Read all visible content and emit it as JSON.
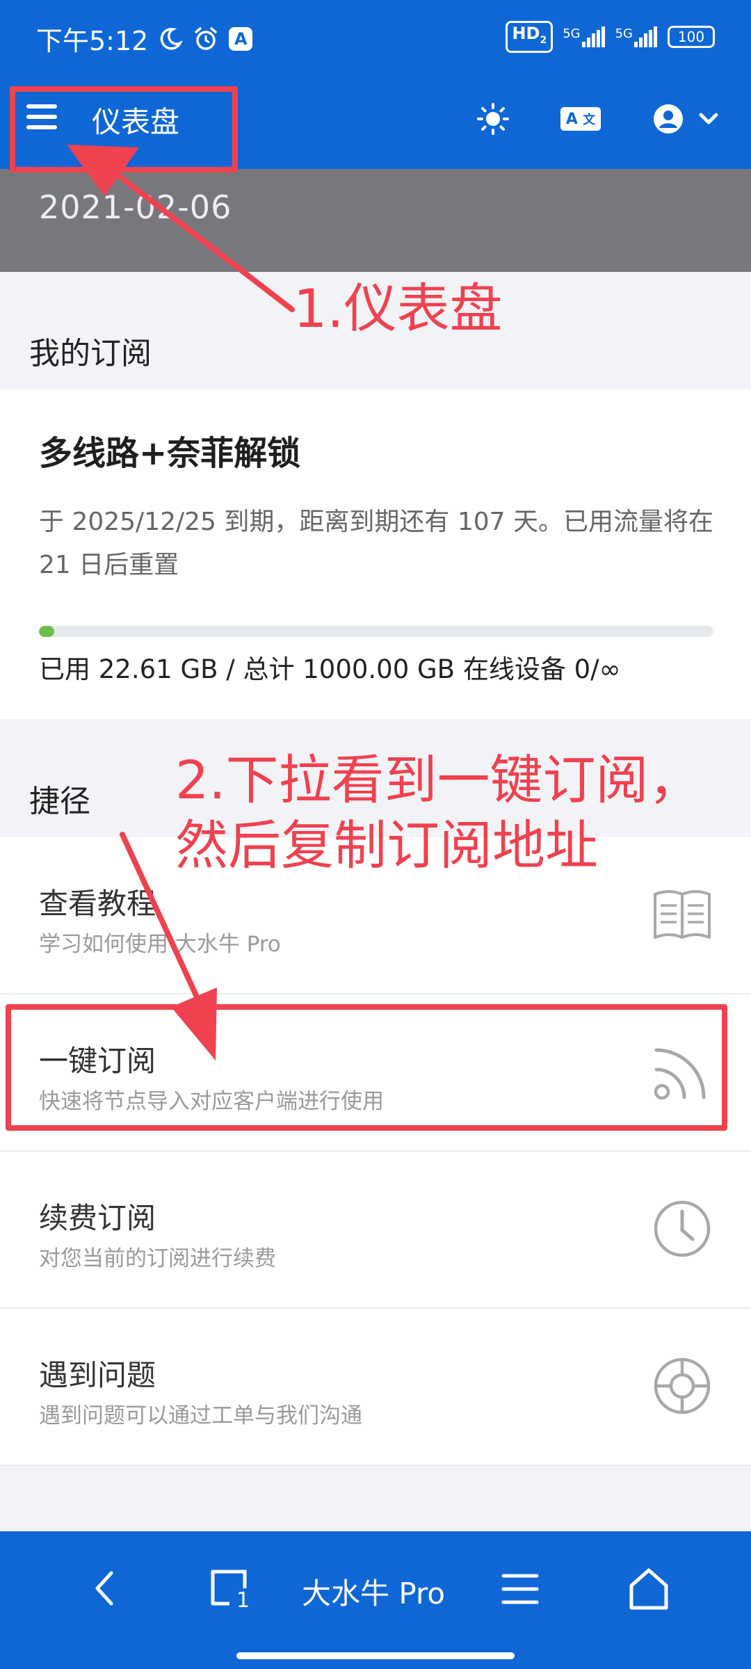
{
  "status_bar": {
    "time": "下午5:12",
    "hd": "HD",
    "hd_sub": "2",
    "sim1": "5G",
    "sim2": "5G",
    "battery": "100"
  },
  "app_bar": {
    "title": "仪表盘",
    "icons": [
      "menu-icon",
      "brightness-icon",
      "translate-icon",
      "account-icon",
      "chevron-down-icon"
    ],
    "translate_left": "A",
    "translate_right": "文"
  },
  "date_header": "2021-02-06",
  "subscription": {
    "section_title": "我的订阅",
    "plan_name": "多线路+奈菲解锁",
    "description": "于 2025/12/25 到期，距离到期还有 107 天。已用流量将在 21 日后重置",
    "usage_fraction": 0.0226,
    "usage_text": "已用 22.61 GB / 总计 1000.00 GB 在线设备 0/∞"
  },
  "shortcuts": {
    "section_title": "捷径",
    "items": [
      {
        "title": "查看教程",
        "subtitle": "学习如何使用 大水牛 Pro",
        "icon": "book-icon"
      },
      {
        "title": "一键订阅",
        "subtitle": "快速将节点导入对应客户端进行使用",
        "icon": "rss-icon"
      },
      {
        "title": "续费订阅",
        "subtitle": "对您当前的订阅进行续费",
        "icon": "clock-icon"
      },
      {
        "title": "遇到问题",
        "subtitle": "遇到问题可以通过工单与我们沟通",
        "icon": "lifebuoy-icon"
      }
    ]
  },
  "bottom_bar": {
    "title": "大水牛 Pro",
    "tab_count": "1",
    "icons": [
      "back-icon",
      "tabs-icon",
      "menu-icon",
      "home-icon"
    ]
  },
  "annotations": {
    "step1": "1.仪表盘",
    "step2_line1": "2.下拉看到一键订阅，",
    "step2_line2": "然后复制订阅地址",
    "color": "#f0414f"
  },
  "colors": {
    "primary": "#0f67d6",
    "date_band": "#77787c",
    "progress": "#6cc04a",
    "annotation": "#f0414f"
  }
}
